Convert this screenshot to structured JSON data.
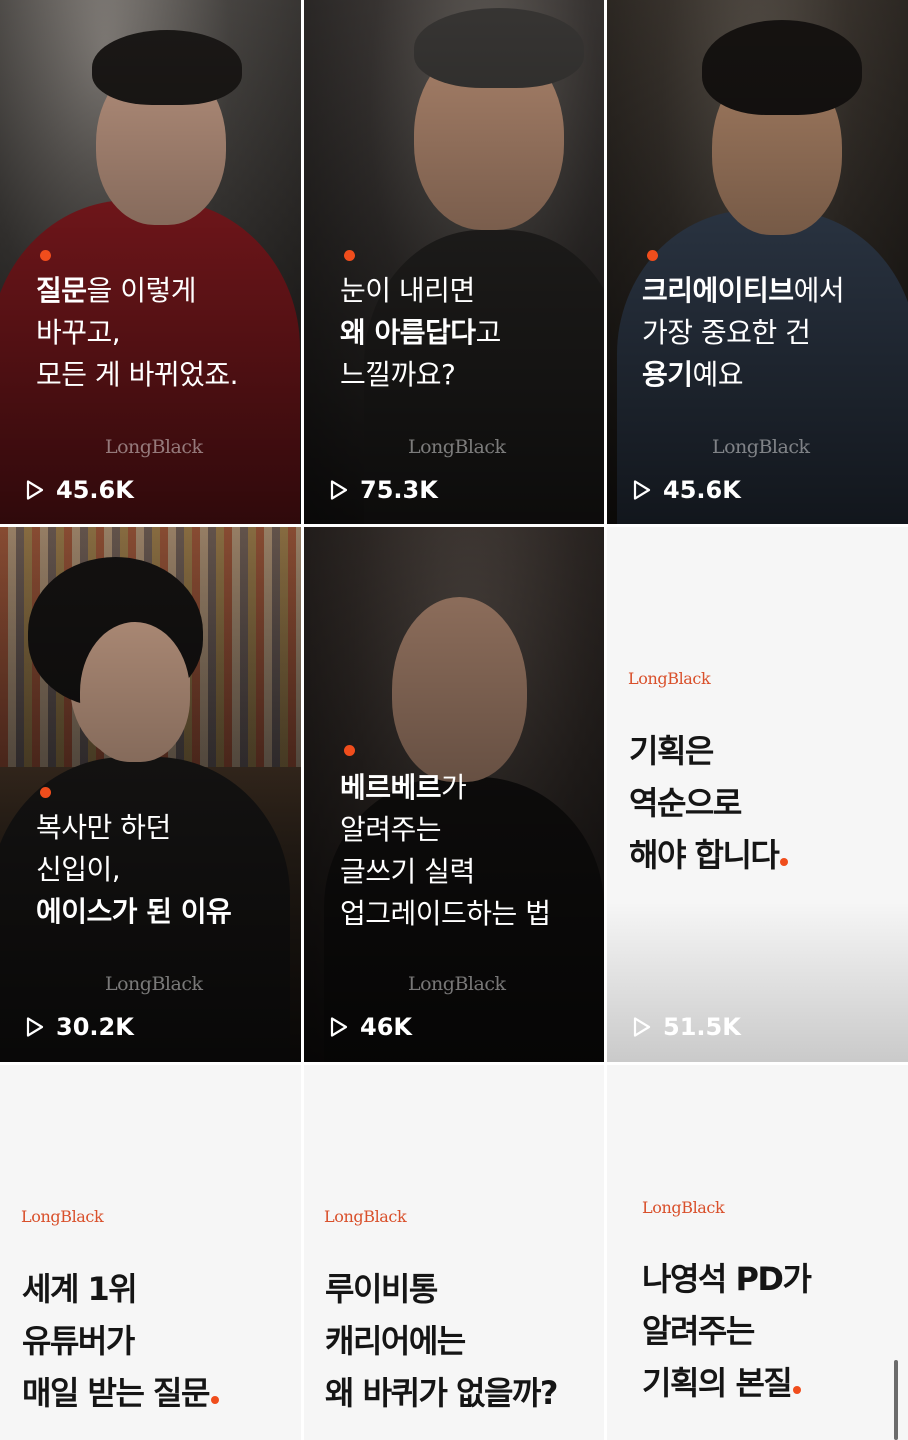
{
  "brand": "LongBlack",
  "colors": {
    "accent": "#f04d1c",
    "brand_red": "#d9502b",
    "tile_white": "#f6f6f6"
  },
  "tiles": [
    {
      "type": "photo",
      "title_lines": [
        [
          "질문",
          "을 이렇게"
        ],
        [
          "바꾸고,"
        ],
        [
          "모든 게 바뀌었죠."
        ]
      ],
      "views": "45.6K"
    },
    {
      "type": "photo",
      "title_lines": [
        [
          "눈이 내리면"
        ],
        [
          "왜 아름답다",
          "고"
        ],
        [
          "느낄까요?"
        ]
      ],
      "views": "75.3K"
    },
    {
      "type": "photo",
      "title_lines": [
        [
          "크리에이티브",
          "에서"
        ],
        [
          "가장 중요한 건"
        ],
        [
          "용기",
          "예요"
        ]
      ],
      "views": "45.6K"
    },
    {
      "type": "photo",
      "title_lines": [
        [
          "복사만 하던"
        ],
        [
          "신입이,"
        ],
        [
          "에이스가 된 이유"
        ]
      ],
      "views": "30.2K"
    },
    {
      "type": "photo",
      "title_lines": [
        [
          "베르베르",
          "가"
        ],
        [
          "알려주는"
        ],
        [
          "글쓰기 실력"
        ],
        [
          "업그레이드하는 법"
        ]
      ],
      "views": "46K"
    },
    {
      "type": "white",
      "title_lines": [
        "기획은",
        "역순으로",
        "해야 합니다"
      ],
      "views": "51.5K"
    },
    {
      "type": "white",
      "title_lines": [
        "세계 1위",
        "유튜버가",
        "매일 받는 질문"
      ]
    },
    {
      "type": "white",
      "title_lines": [
        "루이비통",
        "캐리어에는",
        "왜 바퀴가 없을까?"
      ]
    },
    {
      "type": "white",
      "title_lines": [
        "나영석 PD가",
        "알려주는",
        "기획의 본질"
      ]
    }
  ],
  "icons": {
    "play": "play-icon",
    "dot": "orange-dot-icon"
  }
}
